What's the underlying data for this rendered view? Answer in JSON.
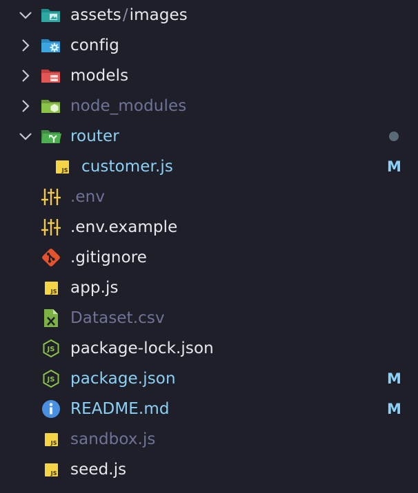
{
  "colors": {
    "background": "#1e1f29",
    "default_text": "#e8e8ee",
    "modified_text": "#8ad1f5",
    "ignored_text": "#6f7397",
    "modified_badge": "#8ad1f5",
    "modified_dot": "#5a6a78"
  },
  "explorer": {
    "items": [
      {
        "name_parts": [
          "assets",
          "/",
          "images"
        ],
        "kind": "folder",
        "expanded": true,
        "icon": "folder-images-icon",
        "state": "default"
      },
      {
        "name": "config",
        "kind": "folder",
        "expanded": false,
        "icon": "folder-config-icon",
        "state": "default"
      },
      {
        "name": "models",
        "kind": "folder",
        "expanded": false,
        "icon": "folder-database-icon",
        "state": "default"
      },
      {
        "name": "node_modules",
        "kind": "folder",
        "expanded": false,
        "icon": "folder-node-icon",
        "state": "ignored"
      },
      {
        "name": "router",
        "kind": "folder",
        "expanded": true,
        "icon": "folder-routes-icon",
        "state": "modified",
        "dot": true
      },
      {
        "name": "customer.js",
        "kind": "file",
        "indent": 1,
        "icon": "javascript-file-icon",
        "state": "modified",
        "badge": "M"
      },
      {
        "name": ".env",
        "kind": "file",
        "icon": "settings-tune-icon",
        "state": "ignored"
      },
      {
        "name": ".env.example",
        "kind": "file",
        "icon": "settings-tune-icon",
        "state": "default"
      },
      {
        "name": ".gitignore",
        "kind": "file",
        "icon": "git-icon",
        "state": "default"
      },
      {
        "name": "app.js",
        "kind": "file",
        "icon": "javascript-file-icon",
        "state": "default"
      },
      {
        "name": "Dataset.csv",
        "kind": "file",
        "icon": "csv-file-icon",
        "state": "ignored"
      },
      {
        "name": "package-lock.json",
        "kind": "file",
        "icon": "nodejs-file-icon",
        "state": "default"
      },
      {
        "name": "package.json",
        "kind": "file",
        "icon": "nodejs-file-icon",
        "state": "modified",
        "badge": "M"
      },
      {
        "name": "README.md",
        "kind": "file",
        "icon": "info-file-icon",
        "state": "modified",
        "badge": "M"
      },
      {
        "name": "sandbox.js",
        "kind": "file",
        "icon": "javascript-file-icon",
        "state": "ignored"
      },
      {
        "name": "seed.js",
        "kind": "file",
        "icon": "javascript-file-icon",
        "state": "default"
      }
    ]
  }
}
